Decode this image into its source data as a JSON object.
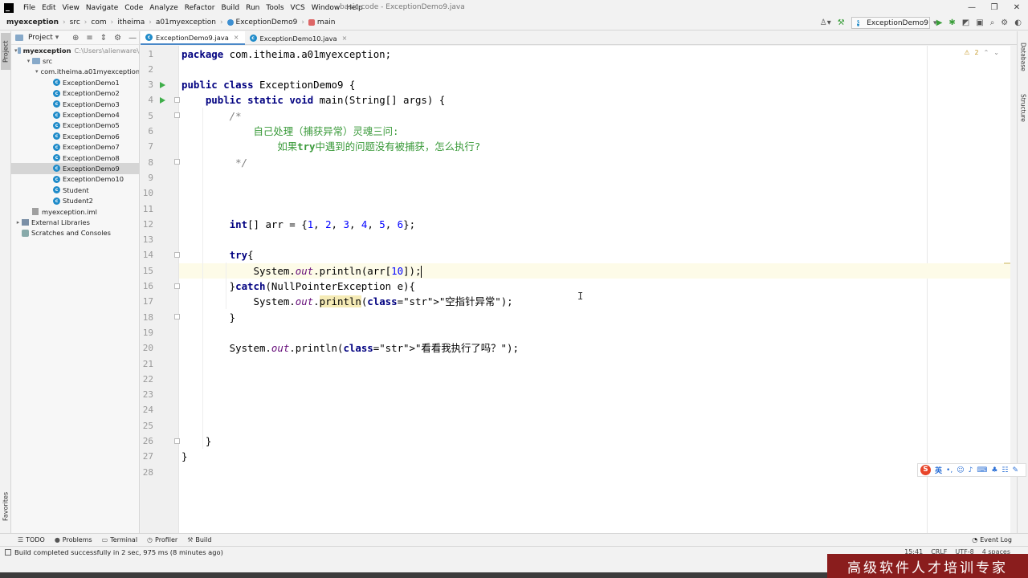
{
  "window": {
    "title": "basic-code - ExceptionDemo9.java",
    "controls": [
      "—",
      "❐",
      "✕"
    ]
  },
  "menu": [
    "File",
    "Edit",
    "View",
    "Navigate",
    "Code",
    "Analyze",
    "Refactor",
    "Build",
    "Run",
    "Tools",
    "VCS",
    "Window",
    "Help"
  ],
  "breadcrumb": [
    "myexception",
    "src",
    "com",
    "itheima",
    "a01myexception",
    "ExceptionDemo9",
    "main"
  ],
  "run_config": "ExceptionDemo9",
  "left_stripe": {
    "project": "Project",
    "favorites": "Favorites"
  },
  "right_stripe": {
    "database": "Database",
    "structure": "Structure"
  },
  "project_panel": {
    "title": "Project",
    "tree": [
      {
        "label": "myexception",
        "hint": "C:\\Users\\alienware\\",
        "depth": 0,
        "type": "folder",
        "expanded": true,
        "bold": true
      },
      {
        "label": "src",
        "depth": 1,
        "type": "folder",
        "expanded": true
      },
      {
        "label": "com.itheima.a01myexception",
        "depth": 2,
        "type": "pkg",
        "expanded": true
      },
      {
        "label": "ExceptionDemo1",
        "depth": 3,
        "type": "class"
      },
      {
        "label": "ExceptionDemo2",
        "depth": 3,
        "type": "class"
      },
      {
        "label": "ExceptionDemo3",
        "depth": 3,
        "type": "class"
      },
      {
        "label": "ExceptionDemo4",
        "depth": 3,
        "type": "class"
      },
      {
        "label": "ExceptionDemo5",
        "depth": 3,
        "type": "class"
      },
      {
        "label": "ExceptionDemo6",
        "depth": 3,
        "type": "class"
      },
      {
        "label": "ExceptionDemo7",
        "depth": 3,
        "type": "class"
      },
      {
        "label": "ExceptionDemo8",
        "depth": 3,
        "type": "class"
      },
      {
        "label": "ExceptionDemo9",
        "depth": 3,
        "type": "class",
        "selected": true
      },
      {
        "label": "ExceptionDemo10",
        "depth": 3,
        "type": "class"
      },
      {
        "label": "Student",
        "depth": 3,
        "type": "class"
      },
      {
        "label": "Student2",
        "depth": 3,
        "type": "class"
      },
      {
        "label": "myexception.iml",
        "depth": 1,
        "type": "iml"
      },
      {
        "label": "External Libraries",
        "depth": 0,
        "type": "lib",
        "collapsed": true
      },
      {
        "label": "Scratches and Consoles",
        "depth": 0,
        "type": "scratch"
      }
    ]
  },
  "editor_tabs": [
    {
      "label": "ExceptionDemo9.java",
      "active": true
    },
    {
      "label": "ExceptionDemo10.java",
      "active": false
    }
  ],
  "editor": {
    "warning_count": "2",
    "current_line": 15,
    "lines": [
      "package com.itheima.a01myexception;",
      "",
      "public class ExceptionDemo9 {",
      "    public static void main(String[] args) {",
      "        /*",
      "            自己处理（捕获异常）灵魂三问:",
      "                如果try中遇到的问题没有被捕获，怎么执行?",
      "         */",
      "",
      "",
      "",
      "        int[] arr = {1, 2, 3, 4, 5, 6};",
      "",
      "        try{",
      "            System.out.println(arr[10]);",
      "        }catch(NullPointerException e){",
      "            System.out.println(\"空指针异常\");",
      "        }",
      "",
      "        System.out.println(\"看看我执行了吗？\");",
      "",
      "",
      "",
      "",
      "",
      "    }",
      "}",
      ""
    ]
  },
  "bottom_tabs": [
    "TODO",
    "Problems",
    "Terminal",
    "Profiler",
    "Build"
  ],
  "event_log": "Event Log",
  "status": {
    "message": "Build completed successfully in 2 sec, 975 ms (8 minutes ago)",
    "position": "15:41",
    "line_sep": "CRLF",
    "encoding": "UTF-8",
    "indent": "4 spaces"
  },
  "ime": {
    "logo": "S",
    "lang": "英"
  },
  "watermark": "高级软件人才培训专家",
  "colors": {
    "keyword": "#000080",
    "string": "#008000",
    "number": "#0000ff",
    "comment": "#808080",
    "current_line": "#fdfbe8",
    "selection": "#d5d5d5",
    "watermark_bg": "#8a1d1d"
  }
}
